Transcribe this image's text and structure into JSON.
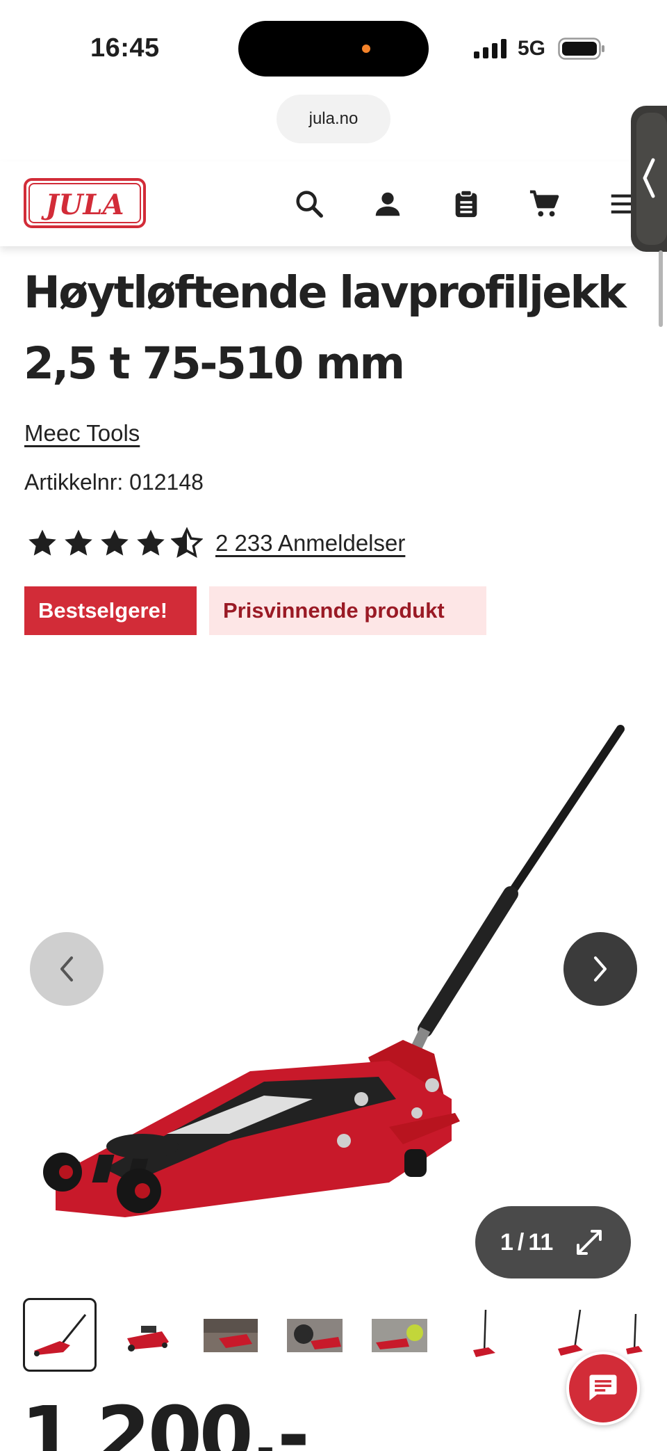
{
  "status_bar": {
    "time": "16:45",
    "network": "5G"
  },
  "browser": {
    "url": "jula.no"
  },
  "header": {
    "logo_text": "JULA",
    "icons": [
      "search-icon",
      "account-icon",
      "list-icon",
      "cart-icon",
      "menu-icon"
    ]
  },
  "product": {
    "title": "Høytløftende lavprofiljekk 2,5 t 75-510 mm",
    "brand": "Meec Tools",
    "article_label": "Artikkelnr:",
    "article_number": "012148",
    "rating": 4.5,
    "rating_max": 5,
    "reviews": "2 233 Anmeldelser",
    "badges": [
      "Bestselgere!",
      "Prisvinnende produkt"
    ],
    "price": "1 200,-"
  },
  "gallery": {
    "current": "1",
    "total": "11",
    "separator": "/"
  },
  "colors": {
    "brand_red": "#d22c38",
    "badge_pink": "#fde6e6",
    "badge_text": "#9a1a25",
    "dark": "#3b3b3b"
  }
}
